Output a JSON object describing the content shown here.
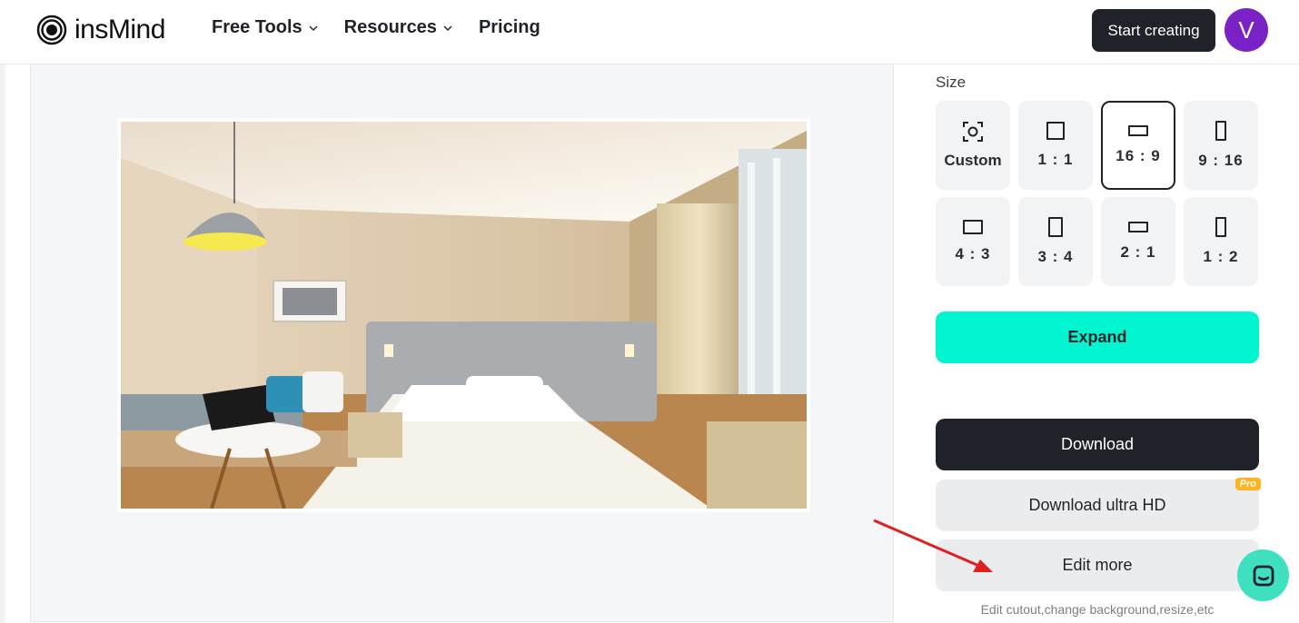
{
  "header": {
    "logo_text": "insMind",
    "nav": [
      {
        "label": "Free Tools",
        "has_dropdown": true
      },
      {
        "label": "Resources",
        "has_dropdown": true
      },
      {
        "label": "Pricing",
        "has_dropdown": false
      }
    ],
    "start_button": "Start creating",
    "avatar_initial": "V"
  },
  "sidebar": {
    "size_label": "Size",
    "sizes": [
      {
        "label": "Custom",
        "icon": "custom-frame-icon",
        "selected": false
      },
      {
        "label": "1 : 1",
        "icon": "square-icon",
        "selected": false
      },
      {
        "label": "16 : 9",
        "icon": "landscape-wide-icon",
        "selected": true
      },
      {
        "label": "9 : 16",
        "icon": "portrait-tall-icon",
        "selected": false
      },
      {
        "label": "4 : 3",
        "icon": "landscape-icon",
        "selected": false
      },
      {
        "label": "3 : 4",
        "icon": "portrait-icon",
        "selected": false
      },
      {
        "label": "2 : 1",
        "icon": "landscape-wide-icon",
        "selected": false
      },
      {
        "label": "1 : 2",
        "icon": "portrait-tall-icon",
        "selected": false
      }
    ],
    "expand_button": "Expand",
    "download_button": "Download",
    "download_hd_button": "Download ultra HD",
    "pro_badge": "Pro",
    "edit_more_button": "Edit more",
    "edit_hint": "Edit cutout,change background,resize,etc"
  },
  "colors": {
    "accent": "#00f5d0",
    "dark": "#1f2329",
    "avatar": "#7b22c7",
    "pro": "#ffb41f",
    "arrow": "#e02020"
  }
}
